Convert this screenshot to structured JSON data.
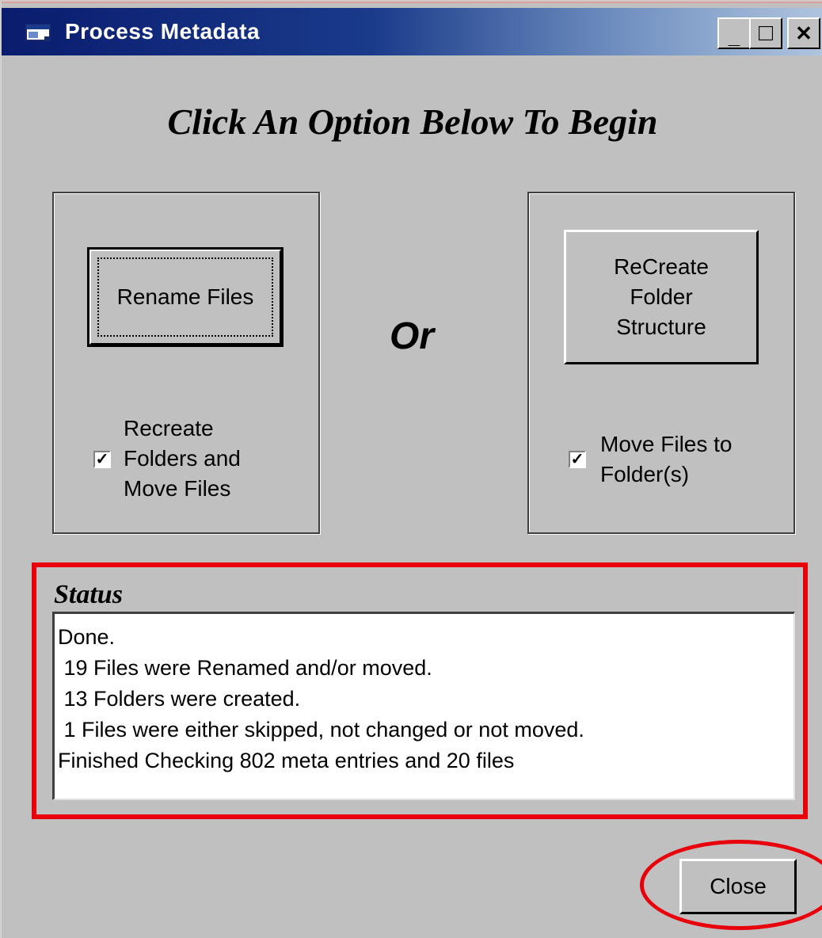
{
  "window": {
    "title": "Process Metadata",
    "minimize_label": "_",
    "maximize_label": "□",
    "close_label": "✕"
  },
  "heading": "Click An Option Below To Begin",
  "left_panel": {
    "button_label": "Rename Files",
    "checkbox_checked": true,
    "checkbox_lines": [
      "Recreate",
      "Folders and",
      "Move Files"
    ]
  },
  "separator": "Or",
  "right_panel": {
    "button_lines": [
      "ReCreate",
      "Folder",
      "Structure"
    ],
    "checkbox_checked": true,
    "checkbox_lines": [
      "Move Files to",
      "Folder(s)"
    ]
  },
  "status": {
    "label": "Status",
    "lines": [
      "Done.",
      " 19 Files were Renamed and/or moved.",
      " 13 Folders were created.",
      " 1 Files were either skipped, not changed or not moved.",
      "Finished Checking 802 meta entries and 20 files"
    ]
  },
  "close_button_label": "Close",
  "colors": {
    "titlebar_start": "#0a1c6e",
    "dialog_bg": "#c0c0c0",
    "annotation_red": "#e8000b"
  }
}
